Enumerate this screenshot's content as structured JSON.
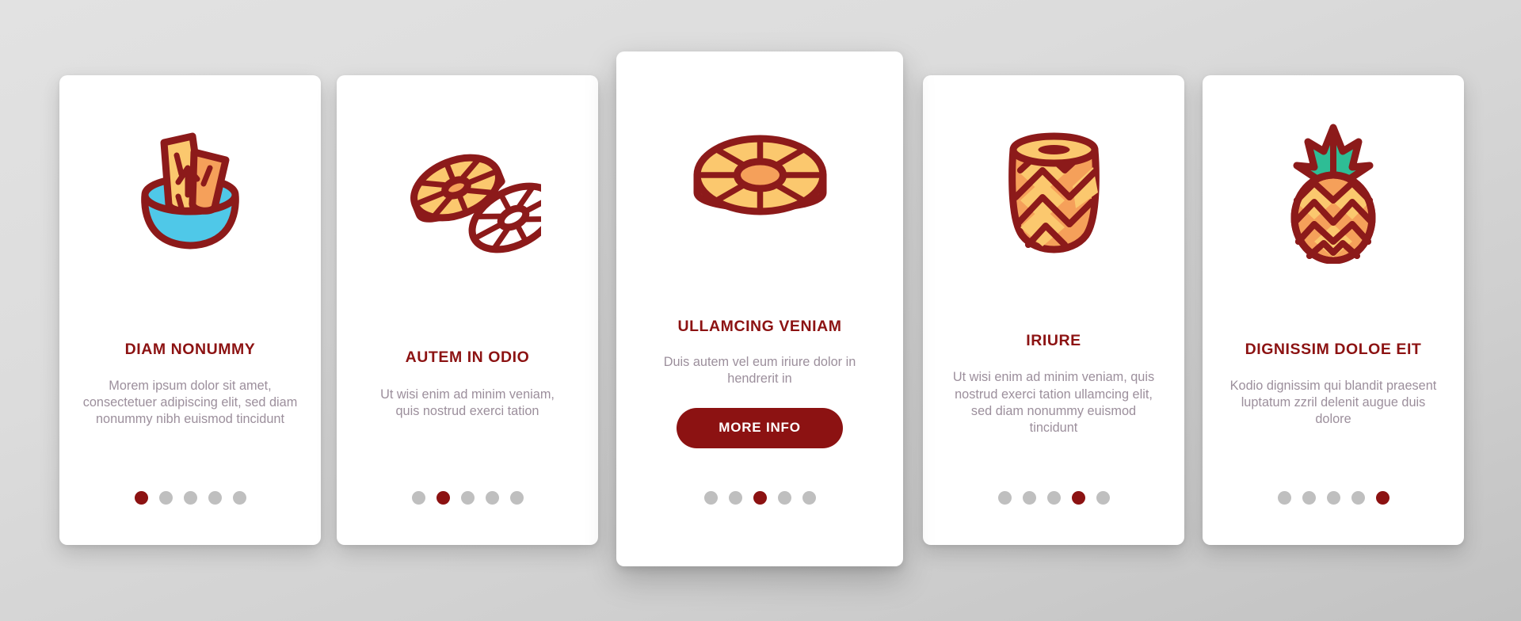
{
  "background": {
    "gradient_from": "#e2e2e2",
    "gradient_to": "#c2c2c2"
  },
  "theme": {
    "accent_red": "#8C1212",
    "body_text": "#9c8f9c",
    "dot_inactive": "#bfbfbf",
    "card_background": "#ffffff",
    "icon_outline": "#8C1A1A",
    "icon_orange": "#F5A05A",
    "icon_yellow": "#FBC86E",
    "icon_cyan": "#4FC8E8",
    "icon_teal": "#2EBD95"
  },
  "cards": [
    {
      "icon": "pineapple-slices-in-bowl-icon",
      "title": "DIAM NONUMMY",
      "body": "Morem ipsum dolor sit amet, consectetuer adipiscing elit, sed diam nonummy nibh euismod tincidunt",
      "dots": {
        "count": 5,
        "active_index": 0
      },
      "has_button": false,
      "featured": false
    },
    {
      "icon": "pineapple-rings-icon",
      "title": "AUTEM IN ODIO",
      "body": "Ut wisi enim ad minim veniam, quis nostrud exerci tation",
      "dots": {
        "count": 5,
        "active_index": 1
      },
      "has_button": false,
      "featured": false
    },
    {
      "icon": "pineapple-slice-disc-icon",
      "title": "ULLAMCING VENIAM",
      "body": "Duis autem vel eum iriure dolor in hendrerit in",
      "button_label": "MORE INFO",
      "dots": {
        "count": 5,
        "active_index": 2
      },
      "has_button": true,
      "featured": true
    },
    {
      "icon": "peeled-pineapple-icon",
      "title": "IRIURE",
      "body": "Ut wisi enim ad minim veniam, quis nostrud exerci tation ullamcing elit, sed diam nonummy euismod tincidunt",
      "dots": {
        "count": 5,
        "active_index": 3
      },
      "has_button": false,
      "featured": false
    },
    {
      "icon": "whole-pineapple-icon",
      "title": "DIGNISSIM DOLOE EIT",
      "body": "Kodio dignissim qui blandit praesent luptatum zzril delenit augue duis dolore",
      "dots": {
        "count": 5,
        "active_index": 4
      },
      "has_button": false,
      "featured": false
    }
  ]
}
